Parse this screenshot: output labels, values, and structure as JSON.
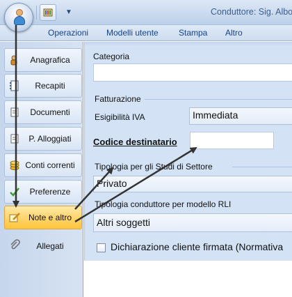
{
  "window": {
    "title": "Conduttore: Sig. Albo"
  },
  "menu": {
    "items": [
      "Operazioni",
      "Modelli utente",
      "Stampa",
      "Altro"
    ]
  },
  "sidebar": {
    "items": [
      {
        "label": "Anagrafica",
        "icon": "person-card-icon"
      },
      {
        "label": "Recapiti",
        "icon": "address-book-icon"
      },
      {
        "label": "Documenti",
        "icon": "documents-icon"
      },
      {
        "label": "P. Alloggiati",
        "icon": "document-icon"
      },
      {
        "label": "Conti correnti",
        "icon": "coins-icon"
      },
      {
        "label": "Preferenze",
        "icon": "checkmark-icon"
      },
      {
        "label": "Note e altro",
        "icon": "notepad-pencil-icon",
        "active": true
      },
      {
        "label": "Allegati",
        "icon": "paperclip-icon"
      }
    ]
  },
  "form": {
    "categoria_label": "Categoria",
    "categoria_value": "",
    "fatturazione_label": "Fatturazione",
    "esigibilita_label": "Esigibilità IVA",
    "esigibilita_value": "Immediata",
    "codice_label": "Codice destinatario",
    "codice_value": "",
    "tipologia_studi_label": "Tipologia per gli Studi di Settore",
    "tipologia_studi_value": "Privato",
    "tipologia_rli_label": "Tipologia conduttore per modello RLI",
    "tipologia_rli_value": "Altri soggetti",
    "dichiarazione_label": "Dichiarazione cliente firmata (Normativa",
    "dichiarazione_checked": false
  },
  "colors": {
    "accent": "#15428b",
    "active_tab": "#ffd46b",
    "arrow": "#333333"
  }
}
